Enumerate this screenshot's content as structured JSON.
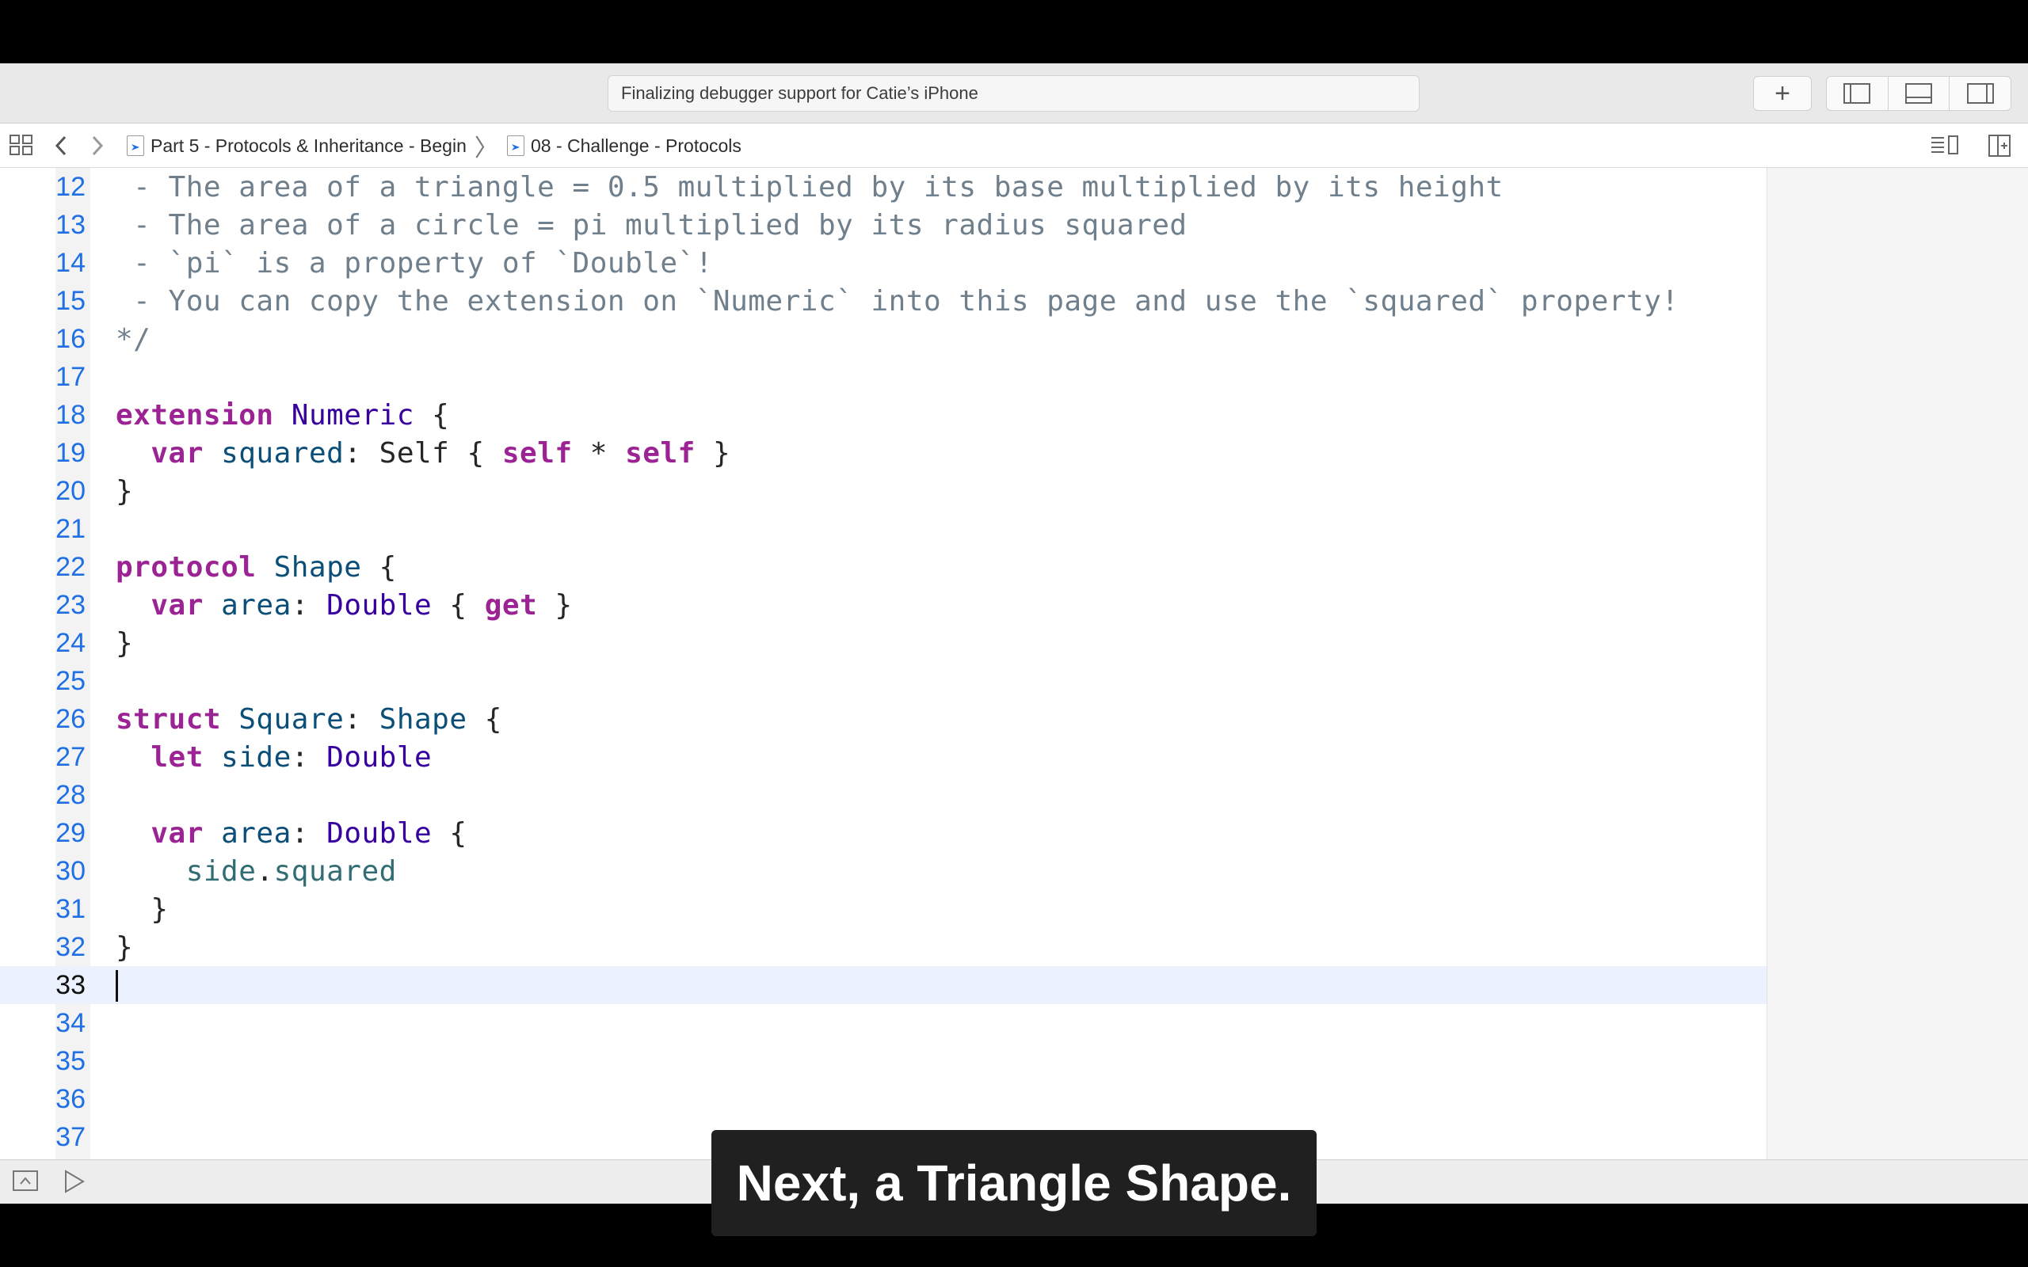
{
  "toolbar": {
    "activity_text": "Finalizing debugger support for Catie’s iPhone",
    "add_label": "+"
  },
  "jumpbar": {
    "crumb_project": "Part 5 - Protocols & Inheritance - Begin",
    "crumb_page": "08 - Challenge - Protocols"
  },
  "editor": {
    "line_numbers": [
      "12",
      "13",
      "14",
      "15",
      "16",
      "17",
      "18",
      "19",
      "20",
      "21",
      "22",
      "23",
      "24",
      "25",
      "26",
      "27",
      "28",
      "29",
      "30",
      "31",
      "32",
      "33",
      "34",
      "35",
      "36",
      "37"
    ],
    "comment_12": " - The area of a triangle = 0.5 multiplied by its base multiplied by its height",
    "comment_13": " - The area of a circle = pi multiplied by its radius squared",
    "comment_14": " - `pi` is a property of `Double`!",
    "comment_15": " - You can copy the extension on `Numeric` into this page and use the `squared` property!",
    "comment_16": "*/",
    "current_line": "33"
  },
  "caption": {
    "text": "Next, a Triangle Shape."
  }
}
